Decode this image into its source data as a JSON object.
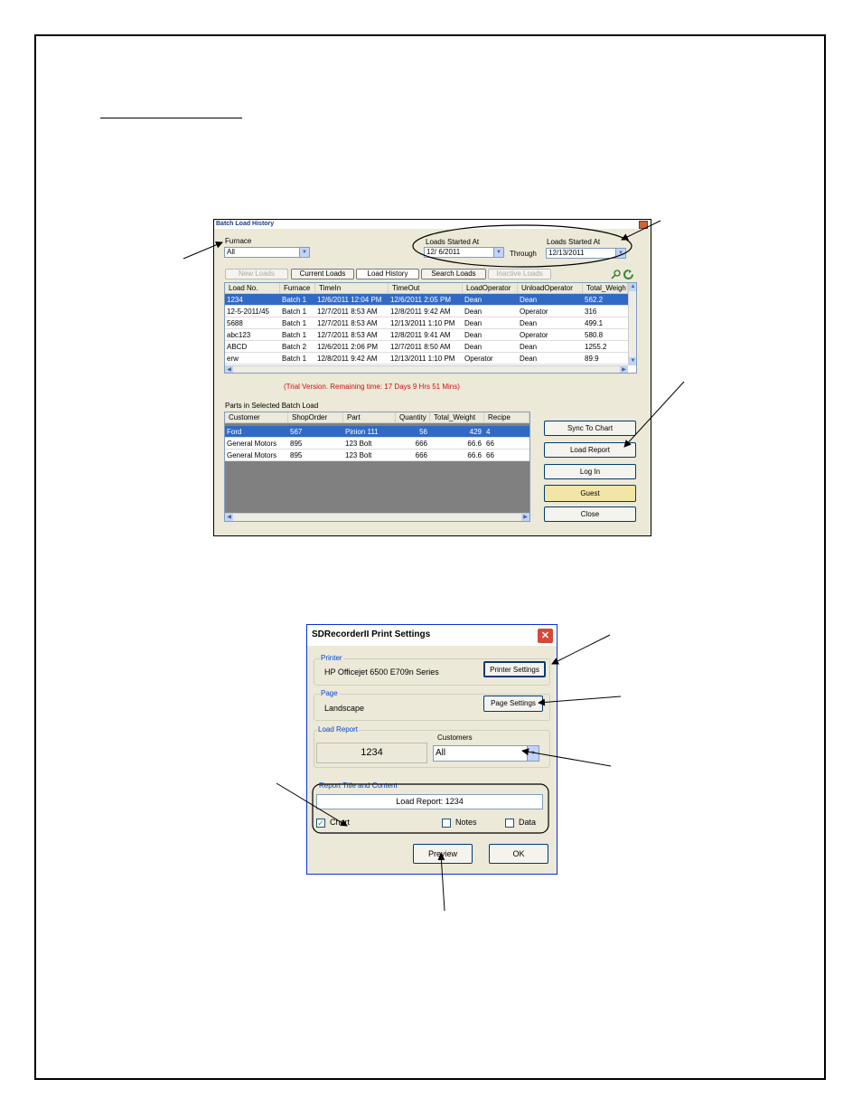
{
  "batch_window": {
    "title": "Batch Load History",
    "furnace_label": "Furnace",
    "furnace_value": "All",
    "loads_started_label_1": "Loads Started At",
    "date_from": "12/ 6/2011",
    "through_label": "Through",
    "loads_started_label_2": "Loads Started At",
    "date_to": "12/13/2011",
    "tabs": [
      "New Loads",
      "Current Loads",
      "Load History",
      "Search Loads",
      "Inactive Loads"
    ],
    "loads_columns": [
      "Load No.",
      "Furnace",
      "TimeIn",
      "TimeOut",
      "LoadOperator",
      "UnloadOperator",
      "Total_Weigh"
    ],
    "loads_rows": [
      [
        "1234",
        "Batch 1",
        "12/6/2011 12:04 PM",
        "12/6/2011 2:05 PM",
        "Dean",
        "Dean",
        "562.2"
      ],
      [
        "12-5-2011/45",
        "Batch 1",
        "12/7/2011 8:53 AM",
        "12/8/2011 9:42 AM",
        "Dean",
        "Operator",
        "316"
      ],
      [
        "5688",
        "Batch 1",
        "12/7/2011 8:53 AM",
        "12/13/2011 1:10 PM",
        "Dean",
        "Dean",
        "499.1"
      ],
      [
        "abc123",
        "Batch 1",
        "12/7/2011 8:53 AM",
        "12/8/2011 9:41 AM",
        "Dean",
        "Operator",
        "580.8"
      ],
      [
        "ABCD",
        "Batch 2",
        "12/6/2011 2:06 PM",
        "12/7/2011 8:50 AM",
        "Dean",
        "Dean",
        "1255.2"
      ],
      [
        "erw",
        "Batch 1",
        "12/8/2011 9:42 AM",
        "12/13/2011 1:10 PM",
        "Operator",
        "Dean",
        "89.9"
      ]
    ],
    "trial_text": "(Trial Version.  Remaining time: 17 Days 9 Hrs 51 Mins)",
    "parts_label": "Parts in Selected Batch Load",
    "parts_columns": [
      "Customer",
      "ShopOrder",
      "Part",
      "Quantity",
      "Total_Weight",
      "Recipe"
    ],
    "parts_rows": [
      [
        "Ford",
        "567",
        "Pinion 111",
        "56",
        "429",
        "4"
      ],
      [
        "General Motors",
        "895",
        "123 Bolt",
        "666",
        "66.6",
        "66"
      ],
      [
        "General Motors",
        "895",
        "123 Bolt",
        "666",
        "66.6",
        "66"
      ]
    ],
    "buttons": [
      "Sync To Chart",
      "Load Report",
      "Log In",
      "Guest",
      "Close"
    ]
  },
  "print_dialog": {
    "title": "SDRecorderII Print Settings",
    "printer_label": "Printer",
    "printer_name": "HP Officejet 6500 E709n Series",
    "printer_settings_button": "Printer Settings",
    "page_label": "Page",
    "orientation": "Landscape",
    "page_settings_button": "Page Settings",
    "load_report_label": "Load Report",
    "load_number": "1234",
    "customers_label": "Customers",
    "customers_value": "All",
    "report_title_label": "Report Title and Content",
    "report_title_value": "Load Report:  1234",
    "chart_label": "Chart",
    "notes_label": "Notes",
    "data_label": "Data",
    "preview_button": "Preview",
    "ok_button": "OK"
  },
  "colors": {
    "selection": "#316ac5",
    "window_bg": "#ece9d8",
    "guest_button": "#f2e6a6",
    "trial_text": "#d01010",
    "group_label": "#0046d5"
  }
}
